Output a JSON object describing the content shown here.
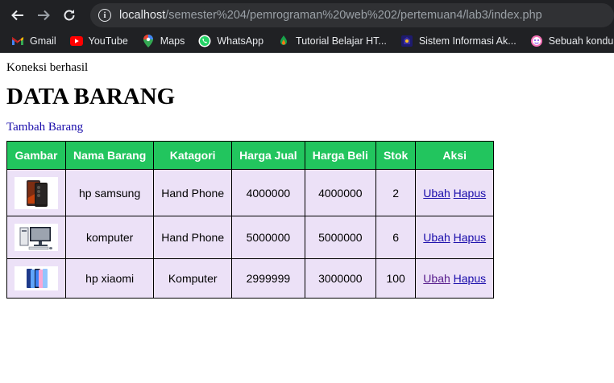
{
  "browser": {
    "url_host": "localhost",
    "url_path": "/semester%204/pemrograman%20web%202/pertemuan4/lab3/index.php",
    "bookmarks": [
      {
        "icon": "gmail-icon",
        "label": "Gmail"
      },
      {
        "icon": "youtube-icon",
        "label": "YouTube"
      },
      {
        "icon": "maps-icon",
        "label": "Maps"
      },
      {
        "icon": "whatsapp-icon",
        "label": "WhatsApp"
      },
      {
        "icon": "tutorial-icon",
        "label": "Tutorial Belajar HT..."
      },
      {
        "icon": "siakad-icon",
        "label": "Sistem Informasi Ak..."
      },
      {
        "icon": "konduktor-icon",
        "label": "Sebuah konduktor..."
      }
    ]
  },
  "page": {
    "status": "Koneksi berhasil",
    "title": "DATA BARANG",
    "add_link": "Tambah Barang"
  },
  "table": {
    "headers": [
      "Gambar",
      "Nama Barang",
      "Katagori",
      "Harga Jual",
      "Harga Beli",
      "Stok",
      "Aksi"
    ],
    "rows": [
      {
        "image": "phone-image",
        "name": "hp samsung",
        "category": "Hand Phone",
        "sell": "4000000",
        "buy": "4000000",
        "stock": "2",
        "edit": "Ubah",
        "delete": "Hapus"
      },
      {
        "image": "computer-image",
        "name": "komputer",
        "category": "Hand Phone",
        "sell": "5000000",
        "buy": "5000000",
        "stock": "6",
        "edit": "Ubah",
        "delete": "Hapus"
      },
      {
        "image": "phones-image",
        "name": "hp xiaomi",
        "category": "Komputer",
        "sell": "2999999",
        "buy": "3000000",
        "stock": "100",
        "edit": "Ubah",
        "delete": "Hapus"
      }
    ]
  },
  "colors": {
    "header_bg": "#22c55e",
    "cell_bg": "#ece1f7",
    "link": "#1a0dab",
    "chrome_bg": "#202124"
  }
}
